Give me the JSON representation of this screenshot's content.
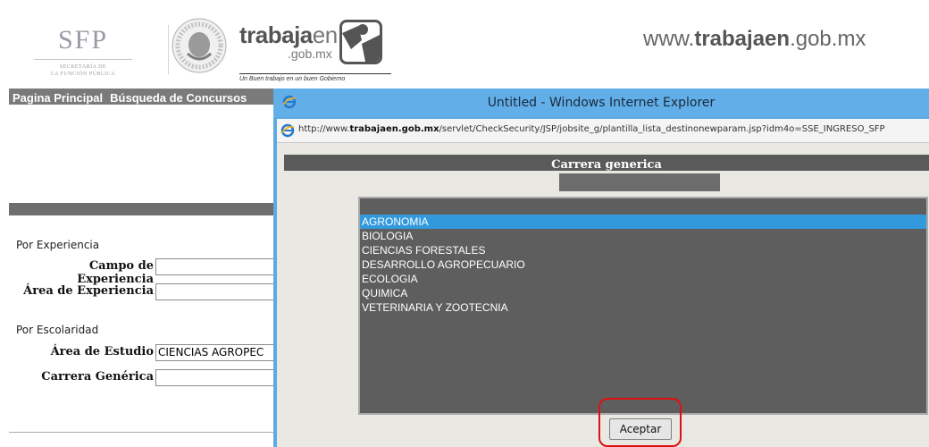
{
  "header": {
    "sfp_logo": "SFP",
    "sfp_subtitle_line1": "SECRETARÍA DE",
    "sfp_subtitle_line2": "LA FUNCIÓN PÚBLICA",
    "brand_word": "trabaja",
    "brand_word_suffix": "en",
    "brand_domain": ".gob.mx",
    "brand_tagline": "Un Buen trabajo en un buen Gobierno",
    "site_url_prefix": "www.",
    "site_url_bold": "trabajaen",
    "site_url_suffix": ".gob.mx"
  },
  "left_page": {
    "nav": [
      "Pagina Principal",
      "Búsqueda de Concursos"
    ],
    "section_experience": "Por Experiencia",
    "fields_experience": [
      {
        "label": "Campo de Experiencia",
        "value": ""
      },
      {
        "label": "Área de Experiencia",
        "value": ""
      }
    ],
    "section_education": "Por Escolaridad",
    "fields_education": [
      {
        "label": "Área de Estudio",
        "value": "CIENCIAS AGROPEC"
      },
      {
        "label": "Carrera Genérica",
        "value": ""
      }
    ]
  },
  "popup": {
    "window_title": "Untitled - Windows Internet Explorer",
    "address_prefix": "http://www.",
    "address_bold": "trabajaen.gob.mx",
    "address_rest": "/servlet/CheckSecurity/JSP/jobsite_g/plantilla_lista_destinonewparam.jsp?idm4o=SSE_INGRESO_SFP",
    "panel_title": "Carrera generica",
    "list_items": [
      "AGRONOMIA",
      "BIOLOGIA",
      "CIENCIAS FORESTALES",
      "DESARROLLO AGROPECUARIO",
      "ECOLOGIA",
      "QUIMICA",
      "VETERINARIA Y ZOOTECNIA"
    ],
    "selected_item": "AGRONOMIA",
    "accept_label": "Aceptar"
  },
  "colors": {
    "accent_selection": "#3399dd",
    "window_frame": "#62aee8",
    "annotation_highlight": "#e01010"
  }
}
